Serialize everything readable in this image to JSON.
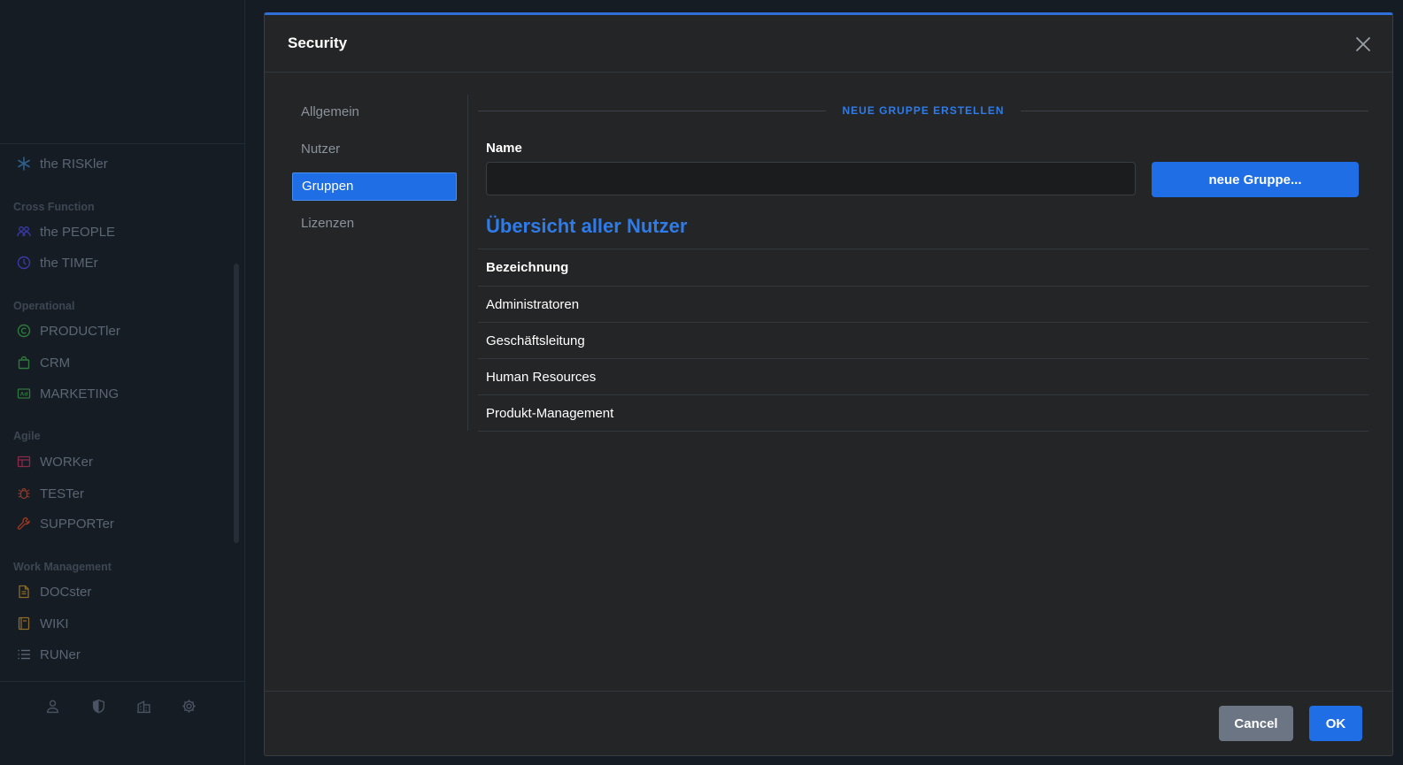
{
  "sidebar": {
    "top_item": {
      "label": "the RISKler",
      "icon": "asterisk-icon",
      "color": "#2e5f8a"
    },
    "sections": [
      {
        "title": "Cross Function",
        "items": [
          {
            "label": "the PEOPLE",
            "icon": "people-icon",
            "color": "#3a3aa8"
          },
          {
            "label": "the TIMEr",
            "icon": "clock-icon",
            "color": "#3a3aa8"
          }
        ]
      },
      {
        "title": "Operational",
        "items": [
          {
            "label": "PRODUCTler",
            "icon": "copyright-icon",
            "color": "#2e7a3c"
          },
          {
            "label": "CRM",
            "icon": "shopping-bag-icon",
            "color": "#2e7a3c"
          },
          {
            "label": "MARKETING",
            "icon": "ad-icon",
            "color": "#2e7a3c"
          }
        ]
      },
      {
        "title": "Agile",
        "items": [
          {
            "label": "WORKer",
            "icon": "board-icon",
            "color": "#8a2a4a"
          },
          {
            "label": "TESTer",
            "icon": "bug-icon",
            "color": "#8a3a2a"
          },
          {
            "label": "SUPPORTer",
            "icon": "wrench-icon",
            "color": "#9a3a22"
          }
        ]
      },
      {
        "title": "Work Management",
        "items": [
          {
            "label": "DOCster",
            "icon": "document-icon",
            "color": "#8a6a2a"
          },
          {
            "label": "WIKI",
            "icon": "book-icon",
            "color": "#8a6a2a"
          },
          {
            "label": "RUNer",
            "icon": "list-icon",
            "color": "#5b6573"
          }
        ]
      }
    ],
    "bottom_icons": [
      "user-icon",
      "shield-icon",
      "building-icon",
      "gear-icon"
    ]
  },
  "modal": {
    "title": "Security",
    "nav": [
      {
        "label": "Allgemein",
        "active": false
      },
      {
        "label": "Nutzer",
        "active": false
      },
      {
        "label": "Gruppen",
        "active": true
      },
      {
        "label": "Lizenzen",
        "active": false
      }
    ],
    "create_divider": "NEUE GRUPPE ERSTELLEN",
    "name_label": "Name",
    "name_value": "",
    "new_group_button": "neue Gruppe...",
    "overview_title": "Übersicht aller Nutzer",
    "table": {
      "header": "Bezeichnung",
      "rows": [
        "Administratoren",
        "Geschäftsleitung",
        "Human Resources",
        "Produkt-Management"
      ]
    },
    "cancel_label": "Cancel",
    "ok_label": "OK"
  },
  "colors": {
    "accent": "#1f6ee5",
    "accent_text": "#2f7be8",
    "cancel": "#6b7584"
  }
}
